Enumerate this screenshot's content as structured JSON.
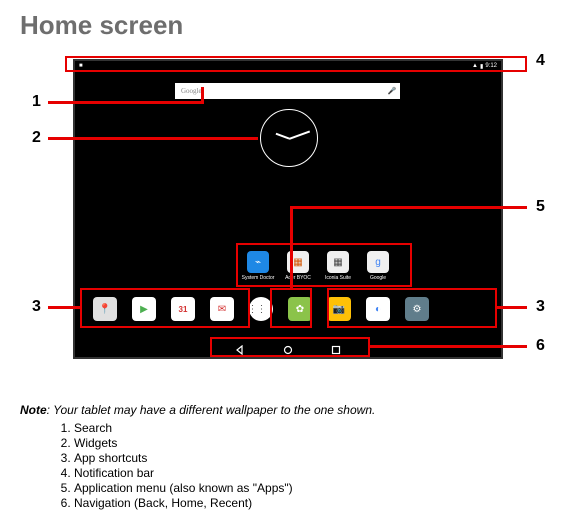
{
  "title": "Home screen",
  "statusbar": {
    "time": "9:12"
  },
  "search": {
    "brand": "Google"
  },
  "folders": [
    {
      "label": "System Doctor",
      "bg": "#1e88e5",
      "glyph": "⌁"
    },
    {
      "label": "Acer BYOC",
      "bg": "#f0f0f0",
      "glyph": "▦"
    },
    {
      "label": "Iconia Suite",
      "bg": "#f0f0f0",
      "glyph": "▦"
    },
    {
      "label": "Google",
      "bg": "#f0f0f0",
      "glyph": "g"
    }
  ],
  "dock_left": [
    {
      "name": "maps-icon",
      "bg": "#e0e0e0",
      "glyph": "📍"
    },
    {
      "name": "play-icon",
      "bg": "#ffffff",
      "glyph": "▶"
    },
    {
      "name": "calendar-icon",
      "bg": "#ffffff",
      "glyph": "31"
    },
    {
      "name": "gmail-icon",
      "bg": "#ffffff",
      "glyph": "✉"
    }
  ],
  "dock_right": [
    {
      "name": "app1-icon",
      "bg": "#8bc34a",
      "glyph": "✿"
    },
    {
      "name": "camera-icon",
      "bg": "#ffc107",
      "glyph": "📷"
    },
    {
      "name": "chrome-icon",
      "bg": "#ffffff",
      "glyph": "◐"
    },
    {
      "name": "settings-icon",
      "bg": "#607d8b",
      "glyph": "⚙"
    }
  ],
  "callouts": {
    "1": "1",
    "2": "2",
    "3": "3",
    "4": "4",
    "5": "5",
    "6": "6"
  },
  "note_label": "Note",
  "note_text": ": Your tablet may have a different wallpaper to the one shown.",
  "legend": [
    "Search",
    "Widgets",
    "App shortcuts",
    "Notification bar",
    "Application menu (also known as \"Apps\")",
    "Navigation (Back, Home, Recent)"
  ]
}
